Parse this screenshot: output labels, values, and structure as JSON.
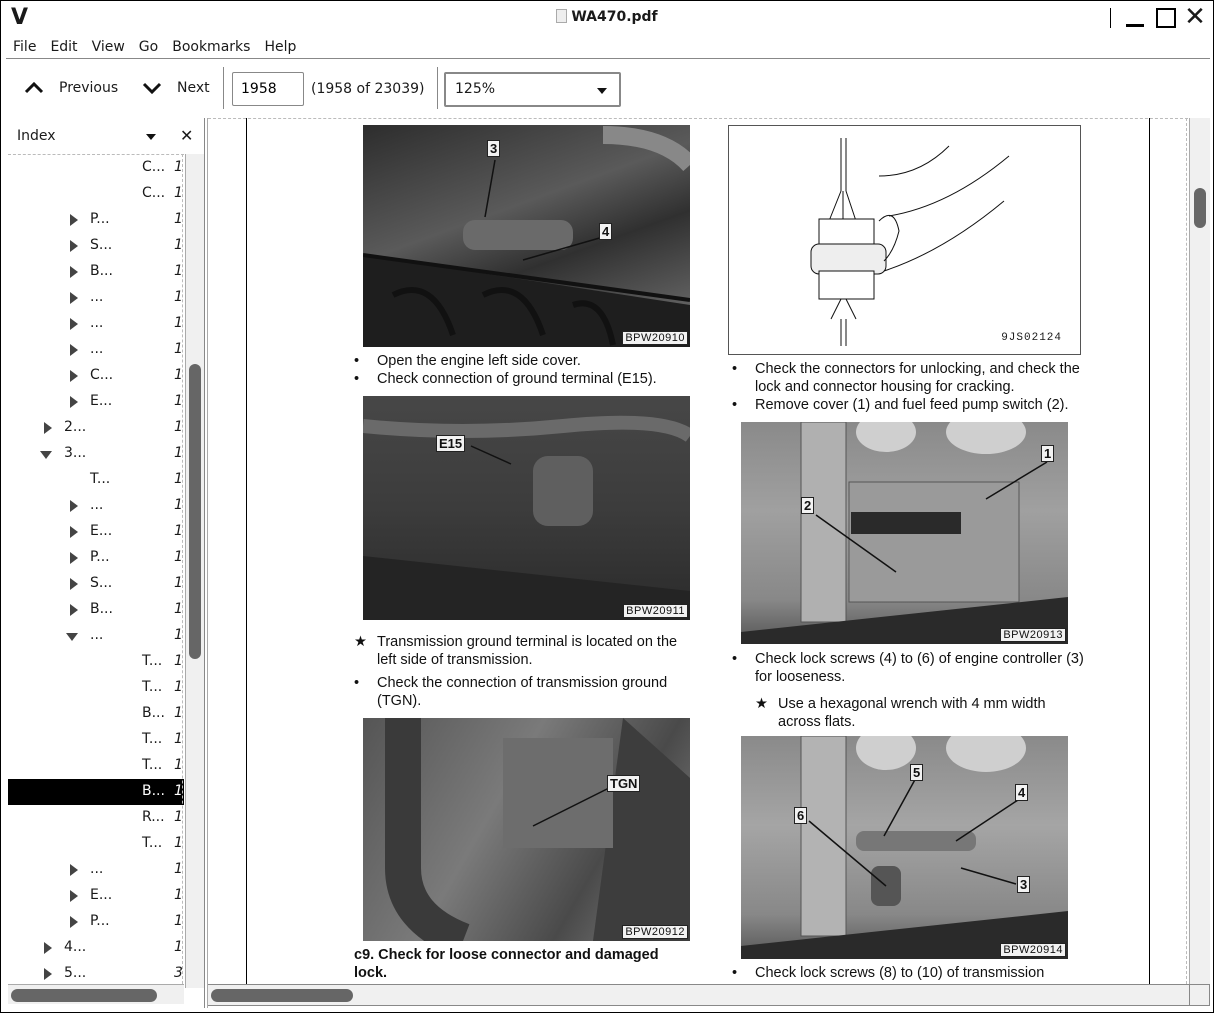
{
  "window": {
    "app_logo": "V",
    "title": "WA470.pdf"
  },
  "menu": [
    "File",
    "Edit",
    "View",
    "Go",
    "Bookmarks",
    "Help"
  ],
  "toolbar": {
    "previous_label": "Previous",
    "next_label": "Next",
    "page_input_value": "1958",
    "page_count": "(1958 of 23039)",
    "zoom_value": "125%"
  },
  "sidebar": {
    "title": "Index",
    "items": [
      {
        "label": "C...",
        "page": "1",
        "level": 4,
        "toggle": "none",
        "selected": false
      },
      {
        "label": "C...",
        "page": "1",
        "level": 4,
        "toggle": "none",
        "selected": false
      },
      {
        "label": "P...",
        "page": "1",
        "level": 3,
        "toggle": "collapsed",
        "selected": false
      },
      {
        "label": "S...",
        "page": "1",
        "level": 3,
        "toggle": "collapsed",
        "selected": false
      },
      {
        "label": "B...",
        "page": "1",
        "level": 3,
        "toggle": "collapsed",
        "selected": false
      },
      {
        "label": "...",
        "page": "1",
        "level": 3,
        "toggle": "collapsed",
        "selected": false
      },
      {
        "label": "...",
        "page": "1",
        "level": 3,
        "toggle": "collapsed",
        "selected": false
      },
      {
        "label": "...",
        "page": "1",
        "level": 3,
        "toggle": "collapsed",
        "selected": false
      },
      {
        "label": "C...",
        "page": "1",
        "level": 3,
        "toggle": "collapsed",
        "selected": false
      },
      {
        "label": "E...",
        "page": "1",
        "level": 3,
        "toggle": "collapsed",
        "selected": false
      },
      {
        "label": "2...",
        "page": "1",
        "level": 2,
        "toggle": "collapsed",
        "selected": false
      },
      {
        "label": "3...",
        "page": "1",
        "level": 2,
        "toggle": "expanded",
        "selected": false
      },
      {
        "label": "T...",
        "page": "1",
        "level": 3,
        "toggle": "none",
        "selected": false
      },
      {
        "label": "...",
        "page": "1",
        "level": 3,
        "toggle": "collapsed",
        "selected": false
      },
      {
        "label": "E...",
        "page": "1",
        "level": 3,
        "toggle": "collapsed",
        "selected": false
      },
      {
        "label": "P...",
        "page": "1",
        "level": 3,
        "toggle": "collapsed",
        "selected": false
      },
      {
        "label": "S...",
        "page": "1",
        "level": 3,
        "toggle": "collapsed",
        "selected": false
      },
      {
        "label": "B...",
        "page": "1",
        "level": 3,
        "toggle": "collapsed",
        "selected": false
      },
      {
        "label": "...",
        "page": "1",
        "level": 3,
        "toggle": "expanded",
        "selected": false
      },
      {
        "label": "T...",
        "page": "1",
        "level": 4,
        "toggle": "none",
        "selected": false
      },
      {
        "label": "T...",
        "page": "1",
        "level": 4,
        "toggle": "none",
        "selected": false
      },
      {
        "label": "B...",
        "page": "1",
        "level": 4,
        "toggle": "none",
        "selected": false
      },
      {
        "label": "T...",
        "page": "1",
        "level": 4,
        "toggle": "none",
        "selected": false
      },
      {
        "label": "T...",
        "page": "1",
        "level": 4,
        "toggle": "none",
        "selected": false
      },
      {
        "label": "B...",
        "page": "1",
        "level": 4,
        "toggle": "none",
        "selected": true
      },
      {
        "label": "R...",
        "page": "1",
        "level": 4,
        "toggle": "none",
        "selected": false
      },
      {
        "label": "T...",
        "page": "1",
        "level": 4,
        "toggle": "none",
        "selected": false
      },
      {
        "label": "...",
        "page": "1",
        "level": 3,
        "toggle": "collapsed",
        "selected": false
      },
      {
        "label": "E...",
        "page": "1",
        "level": 3,
        "toggle": "collapsed",
        "selected": false
      },
      {
        "label": "P...",
        "page": "1",
        "level": 3,
        "toggle": "collapsed",
        "selected": false
      },
      {
        "label": "4...",
        "page": "1",
        "level": 2,
        "toggle": "collapsed",
        "selected": false
      },
      {
        "label": "5...",
        "page": "3",
        "level": 2,
        "toggle": "collapsed",
        "selected": false
      }
    ]
  },
  "document": {
    "left_column": {
      "figure1": {
        "tag": "BPW20910",
        "callouts": [
          "3",
          "4"
        ]
      },
      "bullets1": [
        {
          "marker": "•",
          "text": "Open the engine left side cover."
        },
        {
          "marker": "•",
          "text": "Check connection of ground terminal (E15)."
        }
      ],
      "figure2": {
        "tag": "BPW20911",
        "callouts": [
          "E15"
        ]
      },
      "notes2": [
        {
          "marker": "★",
          "text": "Transmission ground terminal is located on the left side of transmission."
        },
        {
          "marker": "•",
          "text": "Check the connection of transmission ground (TGN)."
        }
      ],
      "figure3": {
        "tag": "BPW20912",
        "callouts": [
          "TGN"
        ]
      },
      "heading": "c9. Check for loose connector and damaged lock."
    },
    "right_column": {
      "figure1": {
        "tag": "9JS02124"
      },
      "bullets1": [
        {
          "marker": "•",
          "text": "Check the connectors for unlocking, and check the lock and connector housing for cracking."
        },
        {
          "marker": "•",
          "text": "Remove cover (1) and fuel feed pump switch (2)."
        }
      ],
      "figure2": {
        "tag": "BPW20913",
        "callouts": [
          "1",
          "2"
        ]
      },
      "bullets2": [
        {
          "marker": "•",
          "text": "Check lock screws (4) to (6) of engine controller (3) for looseness."
        }
      ],
      "note2": {
        "marker": "★",
        "text": "Use a hexagonal wrench with 4 mm width across flats."
      },
      "figure3": {
        "tag": "BPW20914",
        "callouts": [
          "5",
          "4",
          "6",
          "3"
        ]
      },
      "bullets3": [
        {
          "marker": "•",
          "text": "Check lock screws (8) to (10) of transmission"
        }
      ]
    }
  }
}
